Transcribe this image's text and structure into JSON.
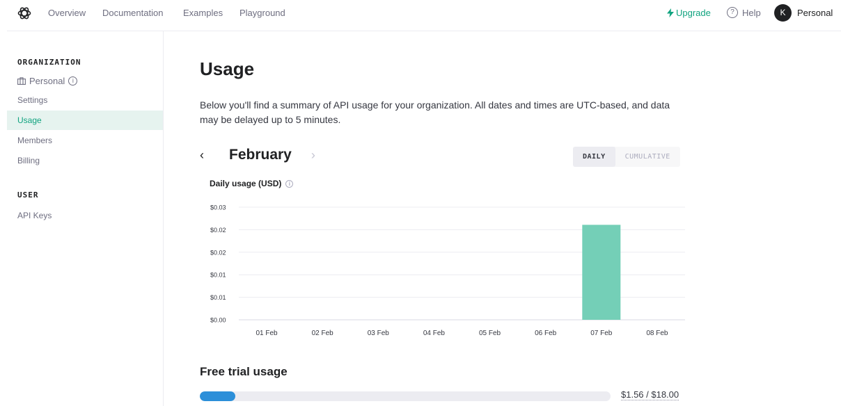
{
  "header": {
    "nav": [
      "Overview",
      "Documentation",
      "Examples",
      "Playground"
    ],
    "upgrade_label": "Upgrade",
    "help_label": "Help",
    "avatar_initial": "K",
    "account_label": "Personal"
  },
  "sidebar": {
    "org_heading": "ORGANIZATION",
    "org_name": "Personal",
    "org_items": [
      "Settings",
      "Usage",
      "Members",
      "Billing"
    ],
    "active_item": "Usage",
    "user_heading": "USER",
    "user_items": [
      "API Keys"
    ]
  },
  "main": {
    "title": "Usage",
    "intro": "Below you'll find a summary of API usage for your organization. All dates and times are UTC-based, and data may be delayed up to 5 minutes.",
    "month": "February",
    "toggle": {
      "daily": "DAILY",
      "cumulative": "CUMULATIVE",
      "selected": "DAILY"
    },
    "chart_title": "Daily usage (USD)",
    "trial_title": "Free trial usage",
    "trial_amount": "$1.56 / $18.00",
    "trial_progress": 0.087
  },
  "colors": {
    "accent": "#10a37f",
    "bar": "#74cfb7",
    "progress": "#2c8fd9"
  },
  "chart_data": {
    "type": "bar",
    "title": "Daily usage (USD)",
    "xlabel": "",
    "ylabel": "",
    "categories": [
      "01 Feb",
      "02 Feb",
      "03 Feb",
      "04 Feb",
      "05 Feb",
      "06 Feb",
      "07 Feb",
      "08 Feb"
    ],
    "values": [
      0,
      0,
      0,
      0,
      0,
      0,
      0.0253,
      0
    ],
    "y_tick_labels": [
      "$0.00",
      "$0.01",
      "$0.01",
      "$0.02",
      "$0.02",
      "$0.03"
    ],
    "ylim": [
      0,
      0.03
    ],
    "grid": true,
    "legend": "none"
  }
}
